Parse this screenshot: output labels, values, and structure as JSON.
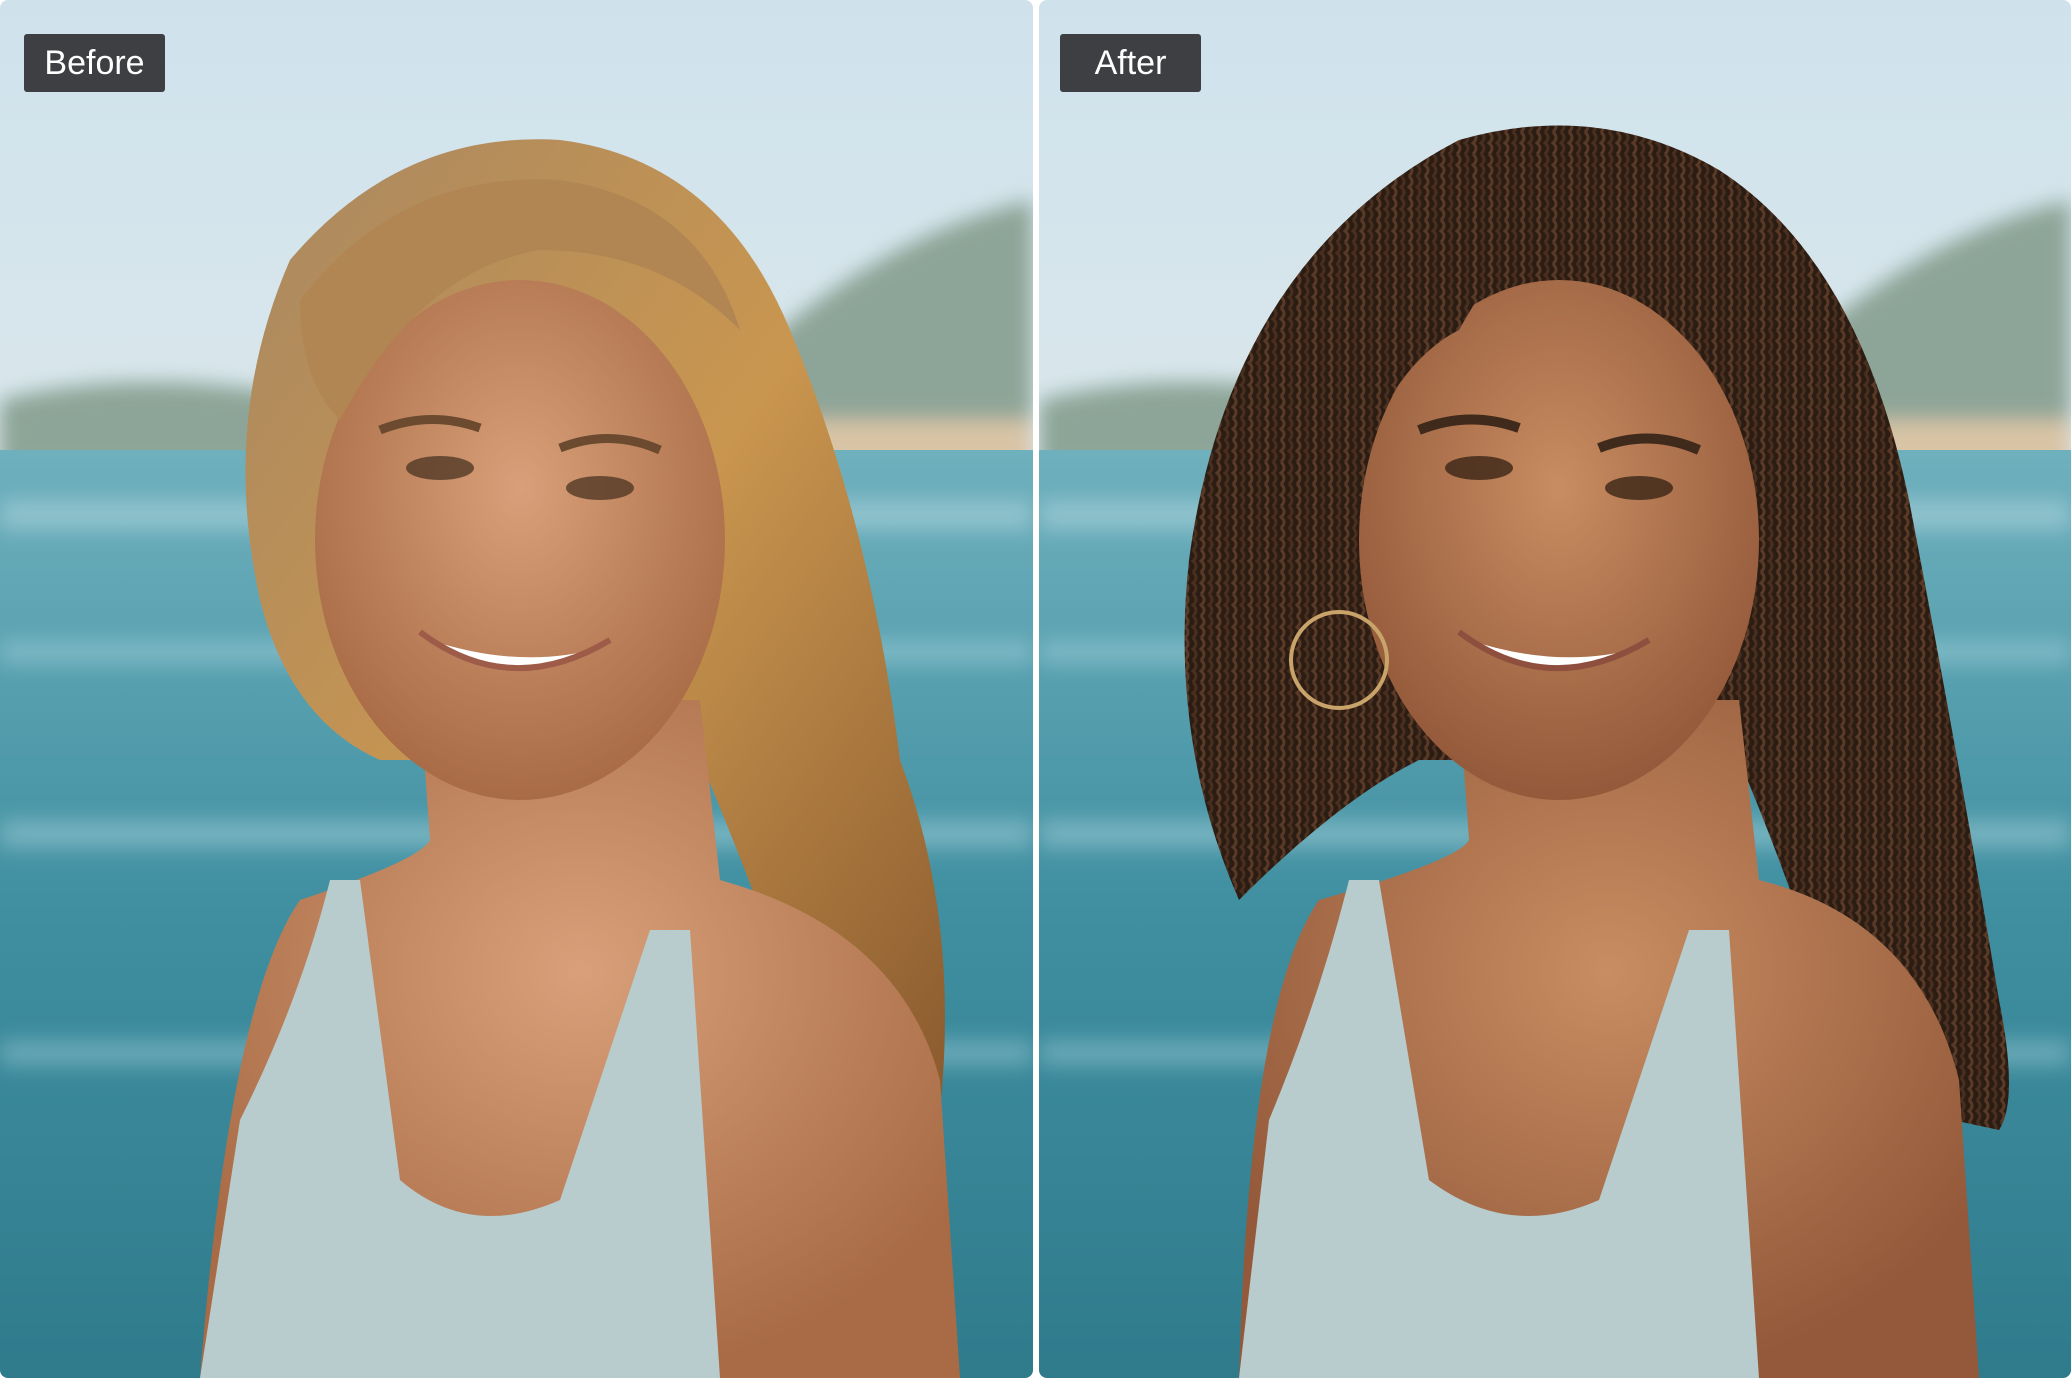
{
  "comparison": {
    "before": {
      "label": "Before"
    },
    "after": {
      "label": "After"
    }
  },
  "colors": {
    "sky_top": "#d6e6ef",
    "sky_bottom": "#eef2ef",
    "sea": "#4f9bab",
    "sea_dark": "#2d7d8f",
    "hills": "#8fa59a",
    "sand": "#d9c3a3",
    "skin": "#c88a5e",
    "skin_shadow": "#9d6440",
    "hair_before": "#b88a55",
    "hair_after": "#2f2018",
    "dress": "#b9cbcf",
    "tag_bg": "#28282a",
    "tag_text": "#ffffff"
  }
}
